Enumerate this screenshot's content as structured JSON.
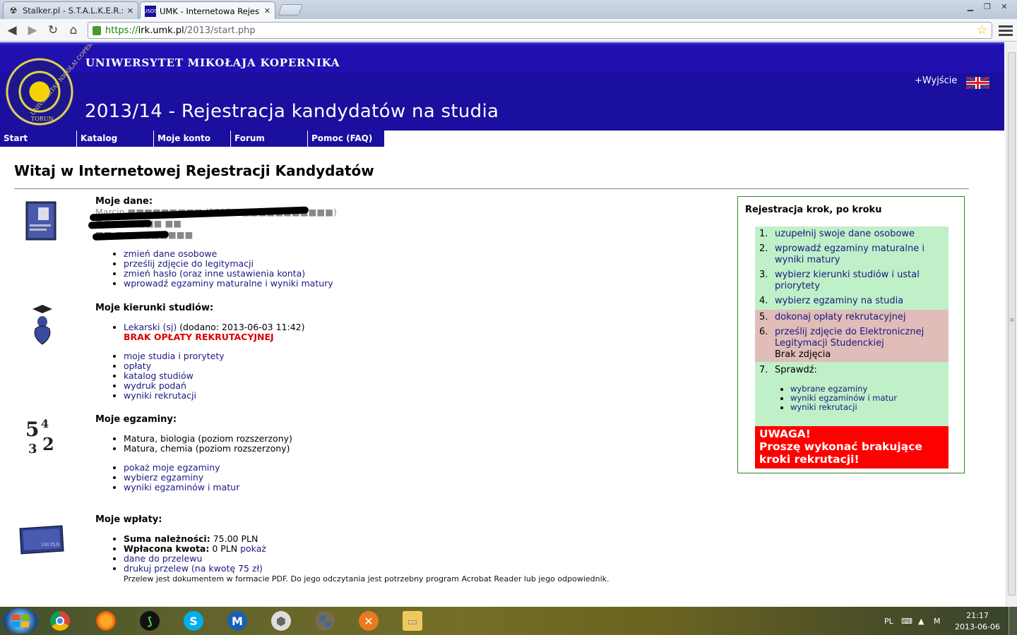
{
  "browser": {
    "tabs": [
      {
        "title": "Stalker.pl - S.T.A.L.K.E.R.: Cl",
        "active": false,
        "favicon": "radiation-icon"
      },
      {
        "title": "UMK - Internetowa Rejestr",
        "active": true,
        "favicon": "usos-icon"
      }
    ],
    "url_scheme": "https://",
    "url_host": "irk.umk.pl",
    "url_path": "/2013/start.php"
  },
  "header": {
    "university": "UNIWERSYTET MIKOŁAJA KOPERNIKA",
    "title": "2013/14 - Rejestracja kandydatów na studia",
    "exit": "+Wyjście",
    "seal_text": [
      "UNIVERSITAS NICOLAI COPERNICI",
      "TORUN"
    ]
  },
  "nav": [
    "Start",
    "Katalog",
    "Moje konto",
    "Forum",
    "Pomoc (FAQ)"
  ],
  "page": {
    "heading": "Witaj w Internetowej Rejestracji Kandydatów",
    "my_data": {
      "title": "Moje dane:",
      "redacted_lines": [
        "Marcin ■■■■■■■■■ (PESEL: ■■■■■■■■■■■)",
        "■■■■■■■■ ■■",
        "■■-■■■ ■■■■■■"
      ],
      "links": [
        "zmień dane osobowe",
        "prześlij zdjęcie do legitymacji",
        "zmień hasło (oraz inne ustawienia konta)",
        "wprowadź egzaminy maturalne i wyniki matury"
      ]
    },
    "my_studies": {
      "title": "Moje kierunki studiów:",
      "program_link": "Lekarski (sj)",
      "program_added": " (dodano: 2013-06-03 11:42)",
      "warning": "BRAK OPŁATY REKRUTACYJNEJ",
      "links": [
        "moje studia i prorytety",
        "opłaty",
        "katalog studiów",
        "wydruk podań",
        "wyniki rekrutacji"
      ]
    },
    "my_exams": {
      "title": "Moje egzaminy:",
      "exams": [
        "Matura, biologia (poziom rozszerzony)",
        "Matura, chemia (poziom rozszerzony)"
      ],
      "links": [
        "pokaż moje egzaminy",
        "wybierz egzaminy",
        "wyniki egzaminów i matur"
      ],
      "icon_digits": [
        "5",
        "4",
        "3",
        "2"
      ]
    },
    "my_payments": {
      "title": "Moje wpłaty:",
      "sum_label": "Suma należności:",
      "sum_value": " 75.00 PLN",
      "paid_label": "Wpłacona kwota:",
      "paid_value": " 0 PLN ",
      "paid_link": "pokaż",
      "transfer_data": "dane do przelewu",
      "print_transfer": "drukuj przelew (na kwotę 75 zł)",
      "note": "Przelew jest dokumentem w formacie PDF. Do jego odczytania jest potrzebny program Acrobat Reader lub jego odpowiednik.",
      "card_label": "100 PLN"
    }
  },
  "steps": {
    "title": "Rejestracja krok, po kroku",
    "items": [
      {
        "n": "1.",
        "text": "uzupełnij swoje dane osobowe",
        "status": "green"
      },
      {
        "n": "2.",
        "text": "wprowadź egzaminy maturalne i wyniki matury",
        "status": "green"
      },
      {
        "n": "3.",
        "text": "wybierz kierunki studiów i ustal priorytety",
        "status": "green"
      },
      {
        "n": "4.",
        "text": "wybierz egzaminy na studia",
        "status": "green"
      },
      {
        "n": "5.",
        "text": "dokonaj opłaty rekrutacyjnej",
        "status": "red"
      },
      {
        "n": "6.",
        "text": "prześlij zdjęcie do Elektronicznej Legitymacji Studenckiej",
        "extra": "Brak zdjęcia",
        "status": "red"
      }
    ],
    "check": {
      "n": "7.",
      "label": "Sprawdź:",
      "links": [
        "wybrane egzaminy",
        "wyniki egzaminów i matur",
        "wyniki rekrutacji"
      ]
    },
    "alert_title": "UWAGA!",
    "alert_text": "Proszę wykonać brakujące kroki rekrutacji!"
  },
  "taskbar": {
    "apps": [
      "windows-explorer-icon",
      "chrome-icon",
      "firefox-icon",
      "razer-icon",
      "skype-icon",
      "malwarebytes-icon",
      "honeycomb-icon",
      "gimp-icon",
      "app-icon",
      "explorer-folder-icon"
    ],
    "lang": "PL",
    "time": "21:17",
    "date": "2013-06-06"
  },
  "colors": {
    "banner": "#1a0f9e",
    "success": "#bff0c8",
    "danger": "#e0bdb8",
    "alert": "#ff0000",
    "warning_text": "#dd0000"
  }
}
